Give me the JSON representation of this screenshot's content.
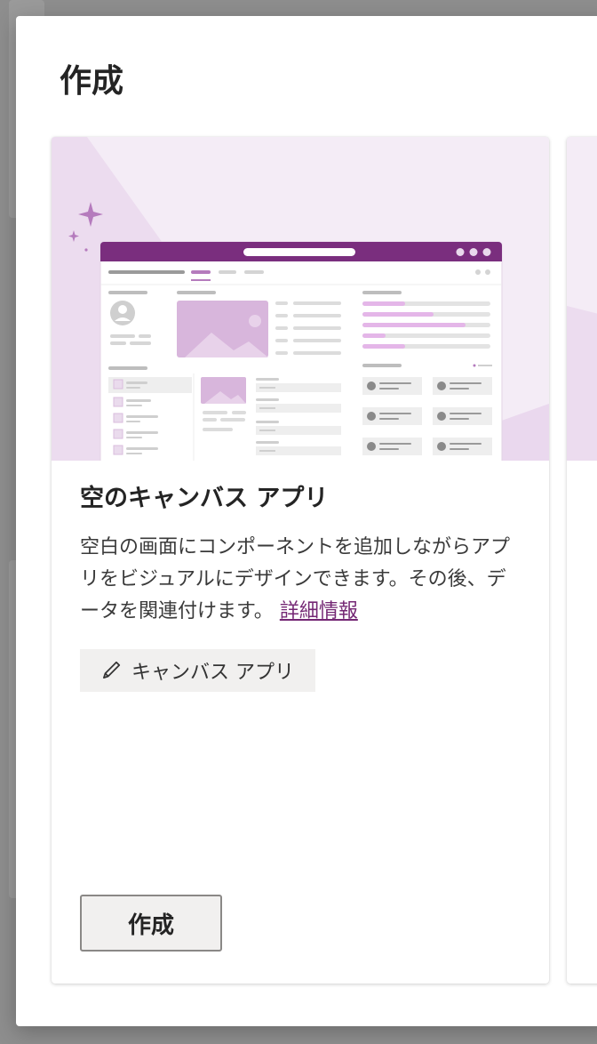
{
  "dialog": {
    "title": "作成"
  },
  "card": {
    "title": "空のキャンバス アプリ",
    "description": "空白の画面にコンポーネントを追加しながらアプリをビジュアルにデザインできます。その後、データを関連付けます。",
    "learn_more": "詳細情報",
    "tag_label": "キャンバス アプリ",
    "create_label": "作成"
  },
  "colors": {
    "accent": "#742774",
    "hero_bg": "#f3ebf5",
    "hero_soft": "#e8d5ec",
    "titlebar": "#7a2e7e"
  },
  "icons": {
    "tag": "pencil-icon",
    "sparkle": "sparkle-icon",
    "avatar": "avatar-icon",
    "image": "image-placeholder-icon"
  }
}
